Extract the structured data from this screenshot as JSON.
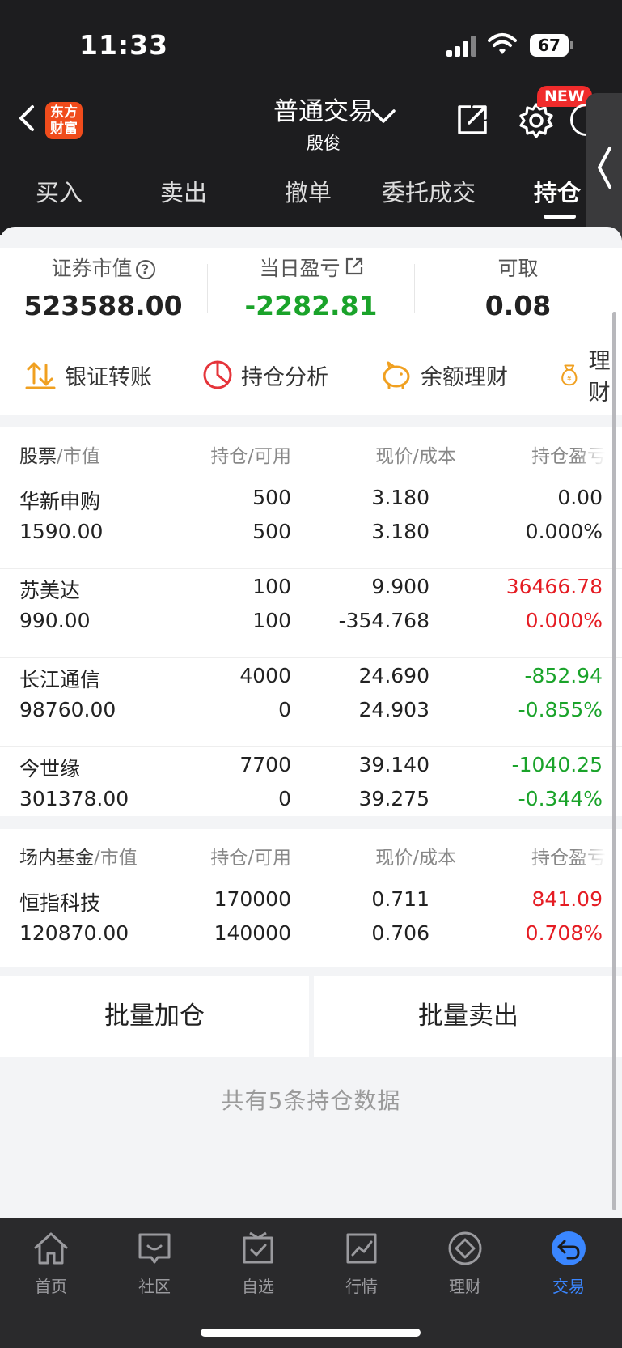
{
  "status": {
    "time": "11:33",
    "battery": "67"
  },
  "nav": {
    "logo_line1": "东方",
    "logo_line2": "财富",
    "title": "普通交易",
    "account": "殷俊",
    "new_badge": "NEW"
  },
  "tabs": [
    {
      "label": "买入"
    },
    {
      "label": "卖出"
    },
    {
      "label": "撤单"
    },
    {
      "label": "委托成交"
    },
    {
      "label": "持仓"
    }
  ],
  "summary": {
    "market_value_label": "证券市值",
    "market_value": "523588.00",
    "daily_pnl_label": "当日盈亏",
    "daily_pnl": "-2282.81",
    "withdrawable_label": "可取",
    "withdrawable": "0.08"
  },
  "quick_actions": [
    {
      "label": "银证转账",
      "icon": "transfer-icon"
    },
    {
      "label": "持仓分析",
      "icon": "pie-chart-icon"
    },
    {
      "label": "余额理财",
      "icon": "piggy-bank-icon"
    },
    {
      "label": "理财",
      "icon": "money-bag-icon"
    }
  ],
  "stocks": {
    "header": {
      "name": "股票",
      "sub": "/市值",
      "col2": "持仓/可用",
      "col3": "现价/成本",
      "col4": "持仓盈亏"
    },
    "rows": [
      {
        "name": "华新申购",
        "value": "1590.00",
        "hold": "500",
        "avail": "500",
        "price": "3.180",
        "cost": "3.180",
        "pnl": "0.00",
        "pnl_pct": "0.000%",
        "color": "neutral"
      },
      {
        "name": "苏美达",
        "value": "990.00",
        "hold": "100",
        "avail": "100",
        "price": "9.900",
        "cost": "-354.768",
        "pnl": "36466.78",
        "pnl_pct": "0.000%",
        "color": "red"
      },
      {
        "name": "长江通信",
        "value": "98760.00",
        "hold": "4000",
        "avail": "0",
        "price": "24.690",
        "cost": "24.903",
        "pnl": "-852.94",
        "pnl_pct": "-0.855%",
        "color": "green"
      },
      {
        "name": "今世缘",
        "value": "301378.00",
        "hold": "7700",
        "avail": "0",
        "price": "39.140",
        "cost": "39.275",
        "pnl": "-1040.25",
        "pnl_pct": "-0.344%",
        "color": "green"
      }
    ]
  },
  "funds": {
    "header": {
      "name": "场内基金",
      "sub": "/市值",
      "col2": "持仓/可用",
      "col3": "现价/成本",
      "col4": "持仓盈亏"
    },
    "rows": [
      {
        "name": "恒指科技",
        "value": "120870.00",
        "hold": "170000",
        "avail": "140000",
        "price": "0.711",
        "cost": "0.706",
        "pnl": "841.09",
        "pnl_pct": "0.708%",
        "color": "red"
      }
    ]
  },
  "batch": {
    "add": "批量加仓",
    "sell": "批量卖出"
  },
  "footer_note": "共有5条持仓数据",
  "tabbar": [
    {
      "label": "首页",
      "icon": "home-icon"
    },
    {
      "label": "社区",
      "icon": "community-icon"
    },
    {
      "label": "自选",
      "icon": "watchlist-icon"
    },
    {
      "label": "行情",
      "icon": "market-icon"
    },
    {
      "label": "理财",
      "icon": "wealth-icon"
    },
    {
      "label": "交易",
      "icon": "trade-icon"
    }
  ],
  "colors": {
    "red": "#e51c23",
    "green": "#1aa32a",
    "active_tab": "#3a86ff",
    "brand": "#f04c1c"
  }
}
